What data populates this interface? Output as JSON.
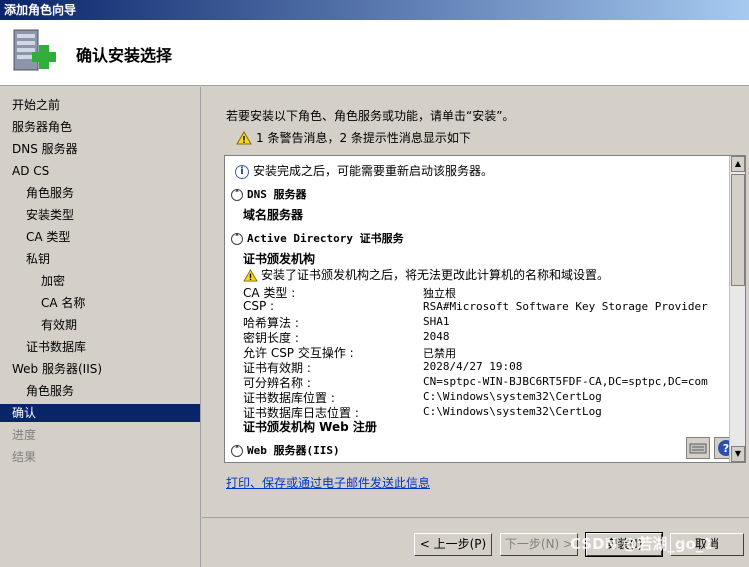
{
  "window": {
    "title": "添加角色向导"
  },
  "header": {
    "title": "确认安装选择"
  },
  "sidebar": {
    "items": [
      {
        "label": "开始之前",
        "state": "normal"
      },
      {
        "label": "服务器角色",
        "state": "normal"
      },
      {
        "label": "DNS 服务器",
        "state": "normal"
      },
      {
        "label": "AD CS",
        "state": "normal"
      },
      {
        "label": "角色服务",
        "state": "normal"
      },
      {
        "label": "安装类型",
        "state": "normal"
      },
      {
        "label": "CA 类型",
        "state": "normal"
      },
      {
        "label": "私钥",
        "state": "normal"
      },
      {
        "label": "加密",
        "state": "normal"
      },
      {
        "label": "CA 名称",
        "state": "normal"
      },
      {
        "label": "有效期",
        "state": "normal"
      },
      {
        "label": "证书数据库",
        "state": "normal"
      },
      {
        "label": "Web 服务器(IIS)",
        "state": "normal"
      },
      {
        "label": "角色服务",
        "state": "normal"
      },
      {
        "label": "确认",
        "state": "active"
      },
      {
        "label": "进度",
        "state": "disabled"
      },
      {
        "label": "结果",
        "state": "disabled"
      }
    ]
  },
  "main": {
    "intro": "若要安装以下角色、角色服务或功能，请单击“安装”。",
    "warning_summary": "1 条警告消息，2 条提示性消息显示如下",
    "panel": {
      "info_message": "安装完成之后，可能需要重新启动该服务器。",
      "dns_section": {
        "title": "DNS 服务器",
        "item": "域名服务器"
      },
      "adcs_section": {
        "title": "Active Directory 证书服务",
        "subtitle": "证书颁发机构",
        "warning": "安装了证书颁发机构之后，将无法更改此计算机的名称和域设置。",
        "props": [
          {
            "label": "CA 类型 :",
            "value": "独立根"
          },
          {
            "label": "CSP :",
            "value": "RSA#Microsoft Software Key Storage Provider"
          },
          {
            "label": "哈希算法 :",
            "value": "SHA1"
          },
          {
            "label": "密钥长度 :",
            "value": "2048"
          },
          {
            "label": "允许 CSP 交互操作 :",
            "value": "已禁用"
          },
          {
            "label": "证书有效期 :",
            "value": "2028/4/27 19:08"
          },
          {
            "label": "可分辨名称 :",
            "value": "CN=sptpc-WIN-BJBC6RT5FDF-CA,DC=sptpc,DC=com"
          },
          {
            "label": "证书数据库位置 :",
            "value": "C:\\Windows\\system32\\CertLog"
          },
          {
            "label": "证书数据库日志位置 :",
            "value": "C:\\Windows\\system32\\CertLog"
          }
        ],
        "web_enroll": "证书颁发机构 Web 注册"
      },
      "iis_section": {
        "title": "Web 服务器(IIS)"
      }
    },
    "link": "打印、保存或通过电子邮件发送此信息"
  },
  "footer": {
    "prev": "< 上一步(P)",
    "next": "下一步(N) >",
    "install": "安装(I)",
    "cancel": "取消"
  },
  "watermark": "CSDN @若湖_go_1"
}
